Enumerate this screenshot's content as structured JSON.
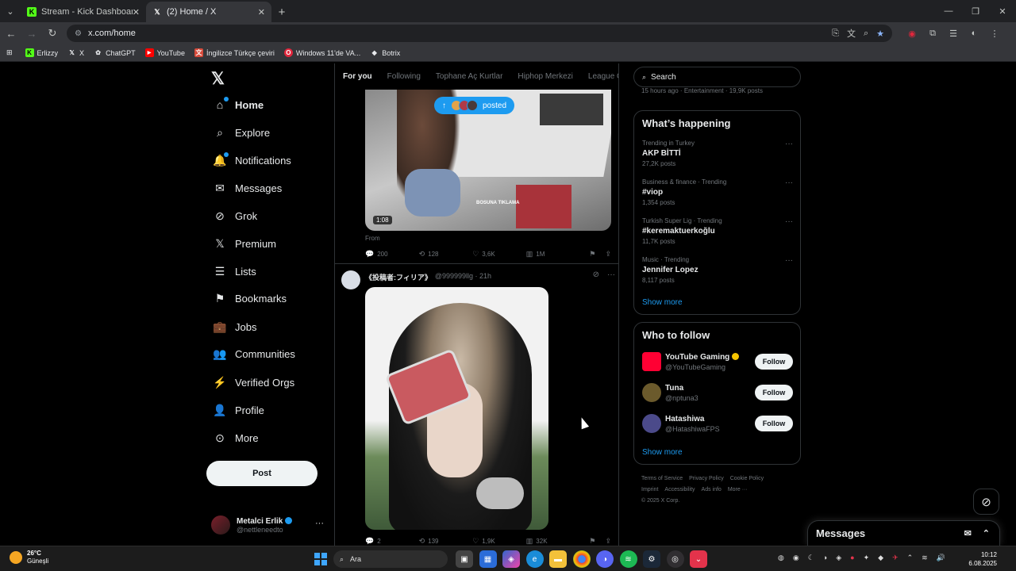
{
  "browser": {
    "tabs": [
      {
        "title": "Stream - Kick Dashboard",
        "icon": "kick-icon",
        "color": "#53fc18"
      },
      {
        "title": "(2) Home / X",
        "icon": "x-icon",
        "color": "#ffffff"
      }
    ],
    "url": "x.com/home",
    "bookmarks": [
      {
        "label": "Erlizzy",
        "icon": "kick-icon",
        "color": "#53fc18"
      },
      {
        "label": "X",
        "icon": "x-icon",
        "color": "#ffffff"
      },
      {
        "label": "ChatGPT",
        "icon": "chatgpt-icon",
        "color": "#cccccc"
      },
      {
        "label": "YouTube",
        "icon": "youtube-icon",
        "color": "#ff0000"
      },
      {
        "label": "İngilizce Türkçe çeviri",
        "icon": "translate-icon",
        "color": "#d64a3a"
      },
      {
        "label": "Windows 11'de VA...",
        "icon": "opera-icon",
        "color": "#e0263c"
      },
      {
        "label": "Botrix",
        "icon": "botrix-icon",
        "color": "#ffffff"
      }
    ]
  },
  "nav": {
    "items": [
      {
        "label": "Home",
        "icon": "home-icon",
        "glyph": "⌂",
        "badge": true
      },
      {
        "label": "Explore",
        "icon": "search-icon",
        "glyph": "⌕",
        "badge": false
      },
      {
        "label": "Notifications",
        "icon": "bell-icon",
        "glyph": "🔔",
        "badge": true
      },
      {
        "label": "Messages",
        "icon": "envelope-icon",
        "glyph": "✉",
        "badge": false
      },
      {
        "label": "Grok",
        "icon": "grok-icon",
        "glyph": "⊘",
        "badge": false
      },
      {
        "label": "Premium",
        "icon": "x-icon",
        "glyph": "𝕏",
        "badge": false
      },
      {
        "label": "Lists",
        "icon": "list-icon",
        "glyph": "☰",
        "badge": false
      },
      {
        "label": "Bookmarks",
        "icon": "bookmark-icon",
        "glyph": "⚑",
        "badge": false
      },
      {
        "label": "Jobs",
        "icon": "briefcase-icon",
        "glyph": "💼",
        "badge": false
      },
      {
        "label": "Communities",
        "icon": "people-icon",
        "glyph": "👥",
        "badge": false
      },
      {
        "label": "Verified Orgs",
        "icon": "lightning-icon",
        "glyph": "⚡",
        "badge": false
      },
      {
        "label": "Profile",
        "icon": "person-icon",
        "glyph": "👤",
        "badge": false
      },
      {
        "label": "More",
        "icon": "more-circle-icon",
        "glyph": "⊙",
        "badge": false
      }
    ],
    "post_label": "Post",
    "account": {
      "name": "Metalci Erlik",
      "handle": "@nettleneedto"
    }
  },
  "feed": {
    "tabs": [
      "For you",
      "Following",
      "Tophane Aç Kurtlar",
      "Hiphop Merkezi",
      "League Of Le"
    ],
    "posted_pill": "posted",
    "tweet1": {
      "duration": "1:08",
      "watermark": "BOSUNA TIKLAMA",
      "from": "From",
      "replies": "200",
      "reposts": "128",
      "likes": "3,6K",
      "views": "1M"
    },
    "tweet2": {
      "name": "《投稿者:フィリア》",
      "handle": "@999999llg · 21h",
      "replies": "2",
      "reposts": "139",
      "likes": "1,9K",
      "views": "32K"
    }
  },
  "sidebar": {
    "search_placeholder": "Search",
    "clipped_text": "15 hours ago · Entertainment · 19,9K posts",
    "happening_title": "What’s happening",
    "trends": [
      {
        "category": "Trending in Turkey",
        "title": "AKP BİTTİ",
        "count": "27,2K posts"
      },
      {
        "category": "Business & finance · Trending",
        "title": "#viop",
        "count": "1,354 posts"
      },
      {
        "category": "Turkish Super Lig · Trending",
        "title": "#keremaktuerkoğlu",
        "count": "11,7K posts"
      },
      {
        "category": "Music · Trending",
        "title": "Jennifer Lopez",
        "count": "8,117 posts"
      }
    ],
    "show_more": "Show more",
    "wtf_title": "Who to follow",
    "follow": [
      {
        "name": "YouTube Gaming",
        "handle": "@YouTubeGaming",
        "button": "Follow",
        "color": "#ff0033",
        "verified": "#f5c400"
      },
      {
        "name": "Tuna",
        "handle": "@nptuna3",
        "button": "Follow",
        "color": "#6b5a2c",
        "verified": ""
      },
      {
        "name": "Hatashiwa",
        "handle": "@HatashiwaFPS",
        "button": "Follow",
        "color": "#4b4a8a",
        "verified": ""
      }
    ],
    "show_more2": "Show more",
    "footer": [
      "Terms of Service",
      "Privacy Policy",
      "Cookie Policy",
      "Imprint",
      "Accessibility",
      "Ads info",
      "More ···",
      "© 2025 X Corp."
    ]
  },
  "drawer": {
    "title": "Messages"
  },
  "taskbar": {
    "weather_temp": "26°C",
    "weather_desc": "Güneşli",
    "search": "Ara",
    "time": "10:12",
    "date": "6.08.2025"
  }
}
